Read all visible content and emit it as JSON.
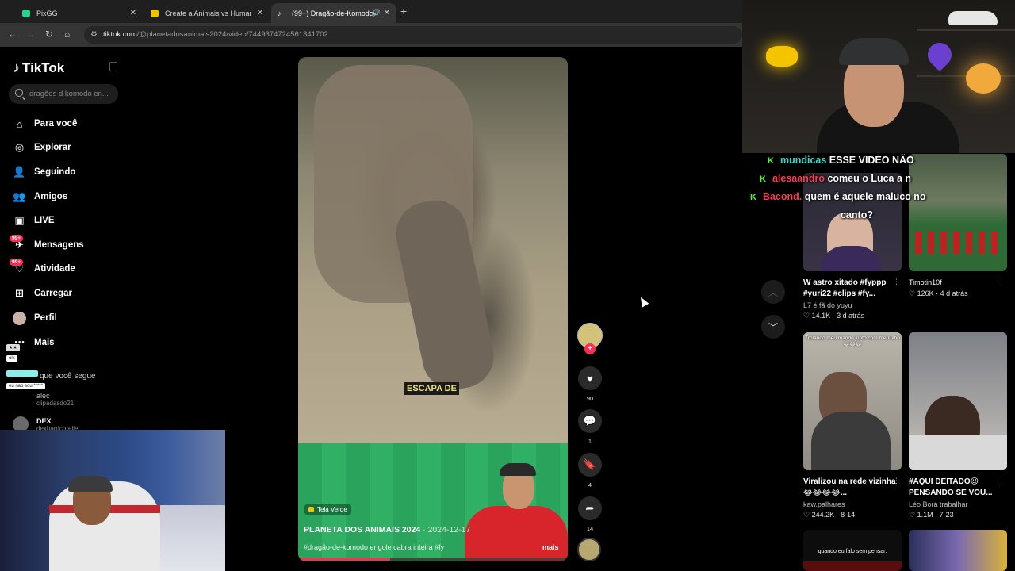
{
  "browser": {
    "tabs": [
      {
        "title": "PixGG",
        "active": false,
        "favicon_color": "#2fd18a"
      },
      {
        "title": "Create a Animais vs Humanos",
        "active": false,
        "favicon_color": "#f2c200"
      },
      {
        "title": "(99+) Dragão-de-Komodo",
        "active": true,
        "favicon_color": "#ffffff"
      }
    ],
    "new_tab_icon": "plus-icon",
    "url_domain": "tiktok.com",
    "url_path": "/@planetadosanimais2024/video/7449374724561341702"
  },
  "tiktok": {
    "logo_text": "TikTok",
    "search_placeholder": "dragões d komodo en...",
    "nav": [
      {
        "label": "Para você",
        "icon": "home-icon"
      },
      {
        "label": "Explorar",
        "icon": "compass-icon"
      },
      {
        "label": "Seguindo",
        "icon": "following-icon"
      },
      {
        "label": "Amigos",
        "icon": "friends-icon"
      },
      {
        "label": "LIVE",
        "icon": "live-icon"
      },
      {
        "label": "Mensagens",
        "icon": "messages-icon",
        "badge": "99+"
      },
      {
        "label": "Atividade",
        "icon": "activity-icon",
        "badge": "99+"
      },
      {
        "label": "Carregar",
        "icon": "upload-icon"
      },
      {
        "label": "Perfil",
        "icon": "profile-avatar"
      },
      {
        "label": "Mais",
        "icon": "more-icon"
      }
    ],
    "following_label": "que você segue",
    "accounts": [
      {
        "name": "alec",
        "handle": "clipadasdo21"
      },
      {
        "name": "DEX",
        "handle": "dexhardcorelie"
      }
    ],
    "chat_chips": [
      "olk",
      "eu nao sou *****"
    ]
  },
  "video": {
    "caption_overlay": "ESCAPA DE",
    "tag_label": "Tela Verde",
    "author": "PLANETA DOS ANIMAIS 2024",
    "date": "· 2024-12-17",
    "description": "#dragão-de-komodo engole cabra inteira #fy",
    "more_label": "mais",
    "progress": 0.34,
    "likes": "90",
    "comments": "1",
    "saves": "4",
    "shares": "14"
  },
  "chat": [
    {
      "user": "mundicas",
      "message": "ESSE VIDEO NÃO",
      "user_color": "#3cd6c8"
    },
    {
      "user": "alesaandro",
      "message": "comeu o Luca a n",
      "user_color": "#fe3b56"
    },
    {
      "user": "Bacond.",
      "message": "quem é aquele maluco no",
      "user_color": "#fe3b56"
    },
    {
      "user": "",
      "message": "canto?",
      "user_color": "#ffffff"
    }
  ],
  "feed": [
    {
      "title": "W astro xitado #fyppp #yuri22 #clips #fy...",
      "author": "L7 é fã do yuyu",
      "likes": "14.1K",
      "time": "3 d atrás"
    },
    {
      "title": "Timotin10f",
      "author": "",
      "likes": "126K",
      "time": "4 d atrás"
    },
    {
      "title": "Viralizou na rede vizinha 😂😂😂😂...",
      "author": "kaw.palhares",
      "likes": "244.2K",
      "time": "8-14",
      "overlay": "Trolando meu marido junto com meu filho 😂😂😂"
    },
    {
      "title": "#AQUI DEITADO😉 PENSANDO SE VOU...",
      "author": "Léo Borá trabalhar",
      "likes": "1.1M",
      "time": "7-23"
    },
    {
      "title": "",
      "author": "",
      "likes": "",
      "time": "",
      "overlay": "quando eu falo sem pensar:"
    }
  ]
}
